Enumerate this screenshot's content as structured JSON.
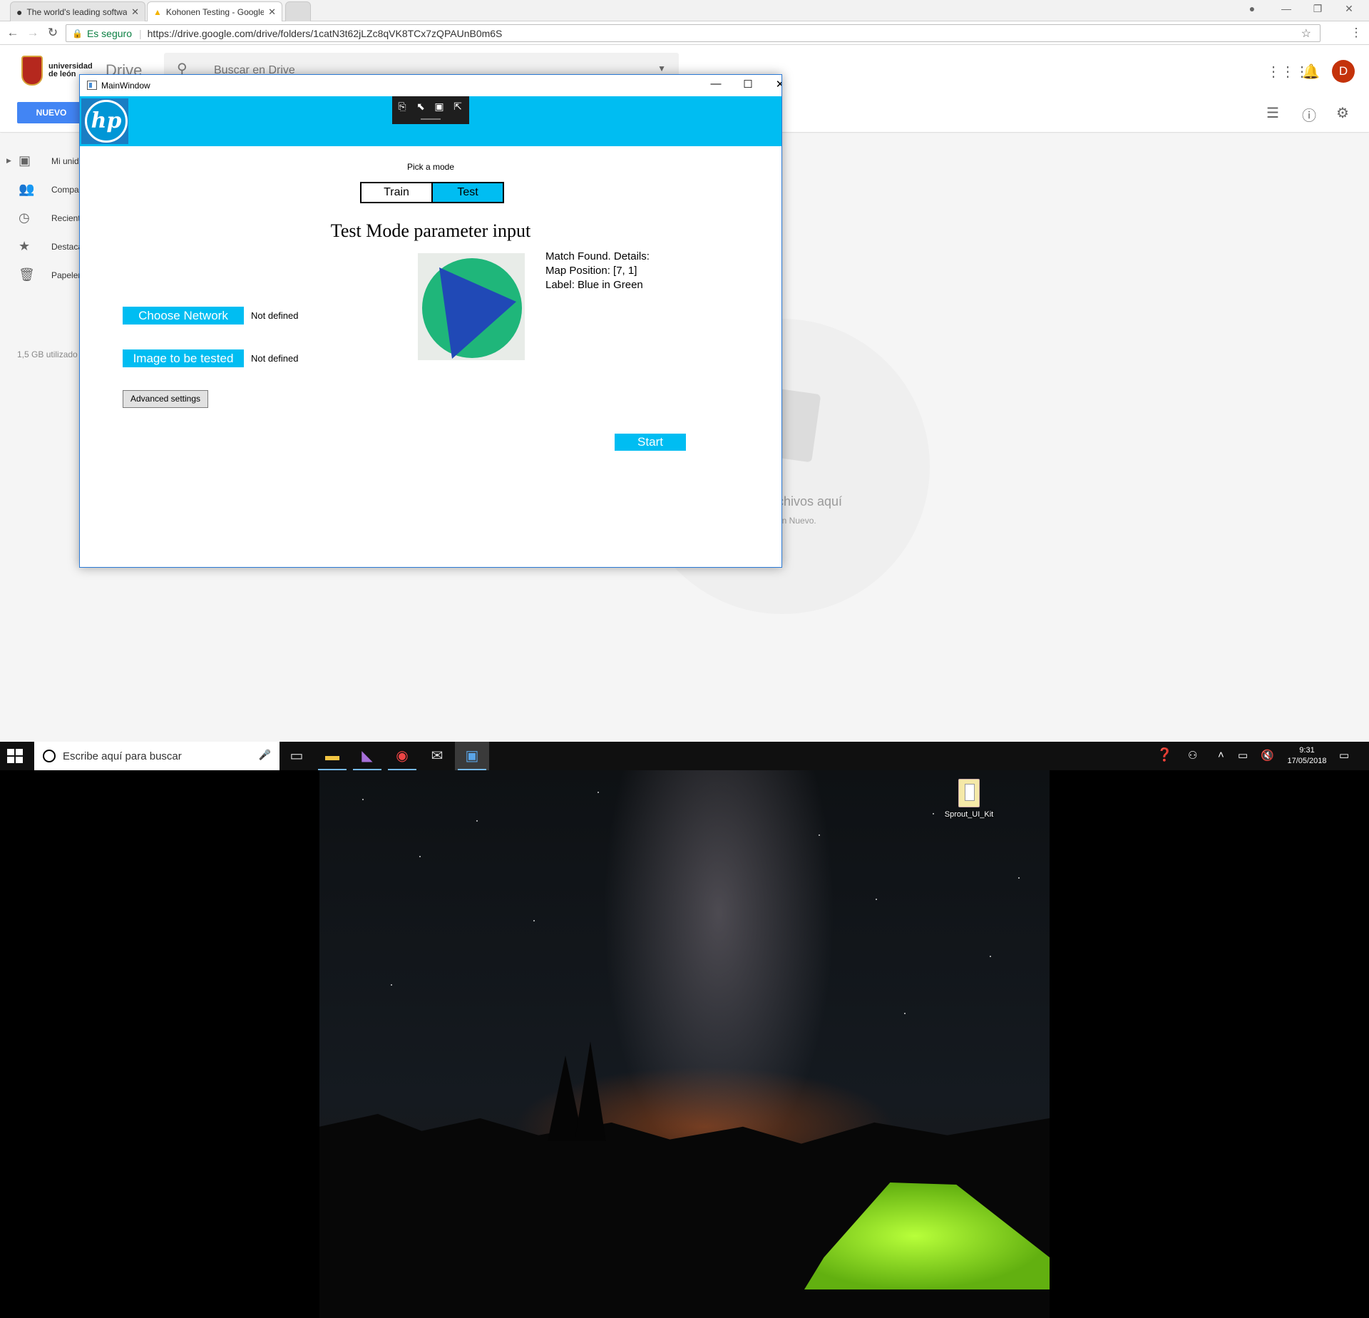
{
  "browser": {
    "tabs": [
      {
        "title": "The world's leading software",
        "icon": "github-icon"
      },
      {
        "title": "Kohonen Testing - Google Drive",
        "icon": "drive-icon"
      }
    ],
    "secure_label": "Es seguro",
    "url": "https://drive.google.com/drive/folders/1catN3t62jLZc8qVK8TCx7zQPAUnB0m6S"
  },
  "drive": {
    "org_line1": "universidad",
    "org_line2": "de león",
    "app_name": "Drive",
    "search_placeholder": "Buscar en Drive",
    "new_button": "NUEVO",
    "avatar_letter": "D",
    "sidebar": [
      {
        "label": "Mi unidad",
        "icon": "drive-icon"
      },
      {
        "label": "Compartido conmigo",
        "icon": "people-icon"
      },
      {
        "label": "Recientes",
        "icon": "clock-icon"
      },
      {
        "label": "Destacados",
        "icon": "star-icon"
      },
      {
        "label": "Papelera",
        "icon": "trash-icon"
      }
    ],
    "storage": "1,5 GB utilizado",
    "empty_title": "chivos aquí",
    "empty_subtitle": "ón Nuevo."
  },
  "app": {
    "window_title": "MainWindow",
    "pick_mode_label": "Pick a mode",
    "modes": [
      "Train",
      "Test"
    ],
    "selected_mode": "Test",
    "heading": "Test Mode parameter input",
    "choose_network_label": "Choose Network",
    "network_status": "Not defined",
    "image_button_label": "Image to be tested",
    "image_status": "Not defined",
    "advanced_label": "Advanced settings",
    "result_lines": [
      "Match Found. Details:",
      "Map Position: [7, 1]",
      "Label: Blue in Green"
    ],
    "start_label": "Start",
    "accent_color": "#00bdf2"
  },
  "taskbar": {
    "search_placeholder": "Escribe aquí para buscar",
    "apps": [
      "task-view-icon",
      "file-explorer-icon",
      "visual-studio-icon",
      "chrome-icon",
      "mail-icon",
      "app-window-icon"
    ],
    "time": "9:31",
    "date": "17/05/2018"
  },
  "desktop": {
    "icon_label": "Sprout_UI_Kit"
  }
}
